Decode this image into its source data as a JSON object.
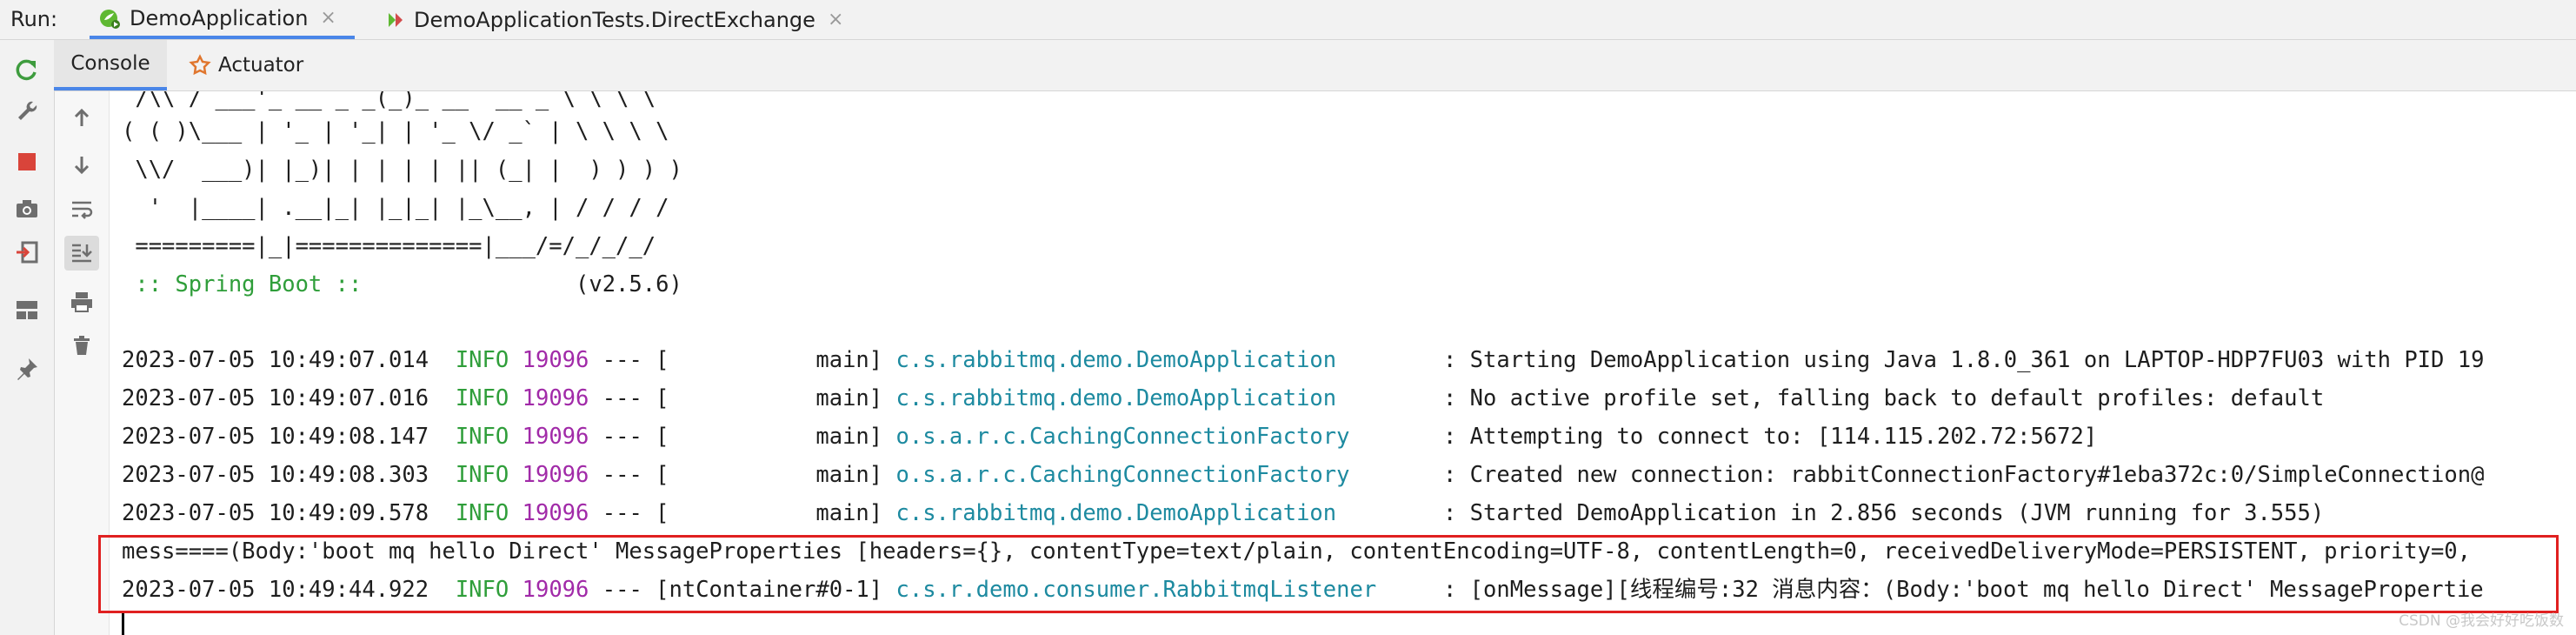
{
  "runbar": {
    "label": "Run:",
    "tabs": [
      {
        "label": "DemoApplication",
        "icon": "spring-run-icon"
      },
      {
        "label": "DemoApplicationTests.DirectExchange",
        "icon": "test-run-icon"
      }
    ],
    "close_glyph": "×"
  },
  "subtabs": [
    {
      "label": "Console"
    },
    {
      "label": "Actuator"
    }
  ],
  "banner": [
    " /\\\\ / ___'_ __ _ _(_)_ __  __ _ \\ \\ \\ \\",
    "( ( )\\___ | '_ | '_| | '_ \\/ _` | \\ \\ \\ \\",
    " \\\\/  ___)| |_)| | | | | || (_| |  ) ) ) )",
    "  '  |____| .__|_| |_|_| |_\\__, | / / / /",
    " =========|_|==============|___/=/_/_/_/"
  ],
  "spring_boot": {
    "label": " :: Spring Boot :: ",
    "version": "               (v2.5.6)"
  },
  "logs": [
    {
      "ts": "2023-07-05 10:49:07.014",
      "level": "INFO",
      "pid": "19096",
      "sep": "--- [",
      "thread": "           main]",
      "logger": "c.s.rabbitmq.demo.DemoApplication",
      "pad": "        ",
      "msg": ": Starting DemoApplication using Java 1.8.0_361 on LAPTOP-HDP7FU03 with PID 19"
    },
    {
      "ts": "2023-07-05 10:49:07.016",
      "level": "INFO",
      "pid": "19096",
      "sep": "--- [",
      "thread": "           main]",
      "logger": "c.s.rabbitmq.demo.DemoApplication",
      "pad": "        ",
      "msg": ": No active profile set, falling back to default profiles: default"
    },
    {
      "ts": "2023-07-05 10:49:08.147",
      "level": "INFO",
      "pid": "19096",
      "sep": "--- [",
      "thread": "           main]",
      "logger": "o.s.a.r.c.CachingConnectionFactory",
      "pad": "       ",
      "msg": ": Attempting to connect to: [114.115.202.72:5672]"
    },
    {
      "ts": "2023-07-05 10:49:08.303",
      "level": "INFO",
      "pid": "19096",
      "sep": "--- [",
      "thread": "           main]",
      "logger": "o.s.a.r.c.CachingConnectionFactory",
      "pad": "       ",
      "msg": ": Created new connection: rabbitConnectionFactory#1eba372c:0/SimpleConnection@"
    },
    {
      "ts": "2023-07-05 10:49:09.578",
      "level": "INFO",
      "pid": "19096",
      "sep": "--- [",
      "thread": "           main]",
      "logger": "c.s.rabbitmq.demo.DemoApplication",
      "pad": "        ",
      "msg": ": Started DemoApplication in 2.856 seconds (JVM running for 3.555)"
    }
  ],
  "mess_line": "mess====(Body:'boot mq hello Direct' MessageProperties [headers={}, contentType=text/plain, contentEncoding=UTF-8, contentLength=0, receivedDeliveryMode=PERSISTENT, priority=0,",
  "listener_log": {
    "ts": "2023-07-05 10:49:44.922",
    "level": "INFO",
    "pid": "19096",
    "sep": "--- [",
    "thread": "ntContainer#0-1]",
    "logger": "c.s.r.demo.consumer.RabbitmqListener",
    "pad": "     ",
    "msg": ": [onMessage][线程编号:32 消息内容：(Body:'boot mq hello Direct' MessagePropertie"
  },
  "watermark": "CSDN @我会好好吃饭数",
  "colors": {
    "info": "#2f9e3a",
    "pid": "#a12aa8",
    "logger": "#1d8aa0",
    "highlight": "#e02020",
    "accent": "#4a86e8"
  },
  "icons": {
    "left": [
      "rerun-icon",
      "wrench-icon",
      "stop-icon",
      "camera-icon",
      "exit-icon",
      "layout-icon",
      "pin-icon"
    ],
    "second": [
      "arrow-up-icon",
      "arrow-down-icon",
      "soft-wrap-icon",
      "scroll-to-end-icon",
      "print-icon",
      "trash-icon"
    ]
  }
}
